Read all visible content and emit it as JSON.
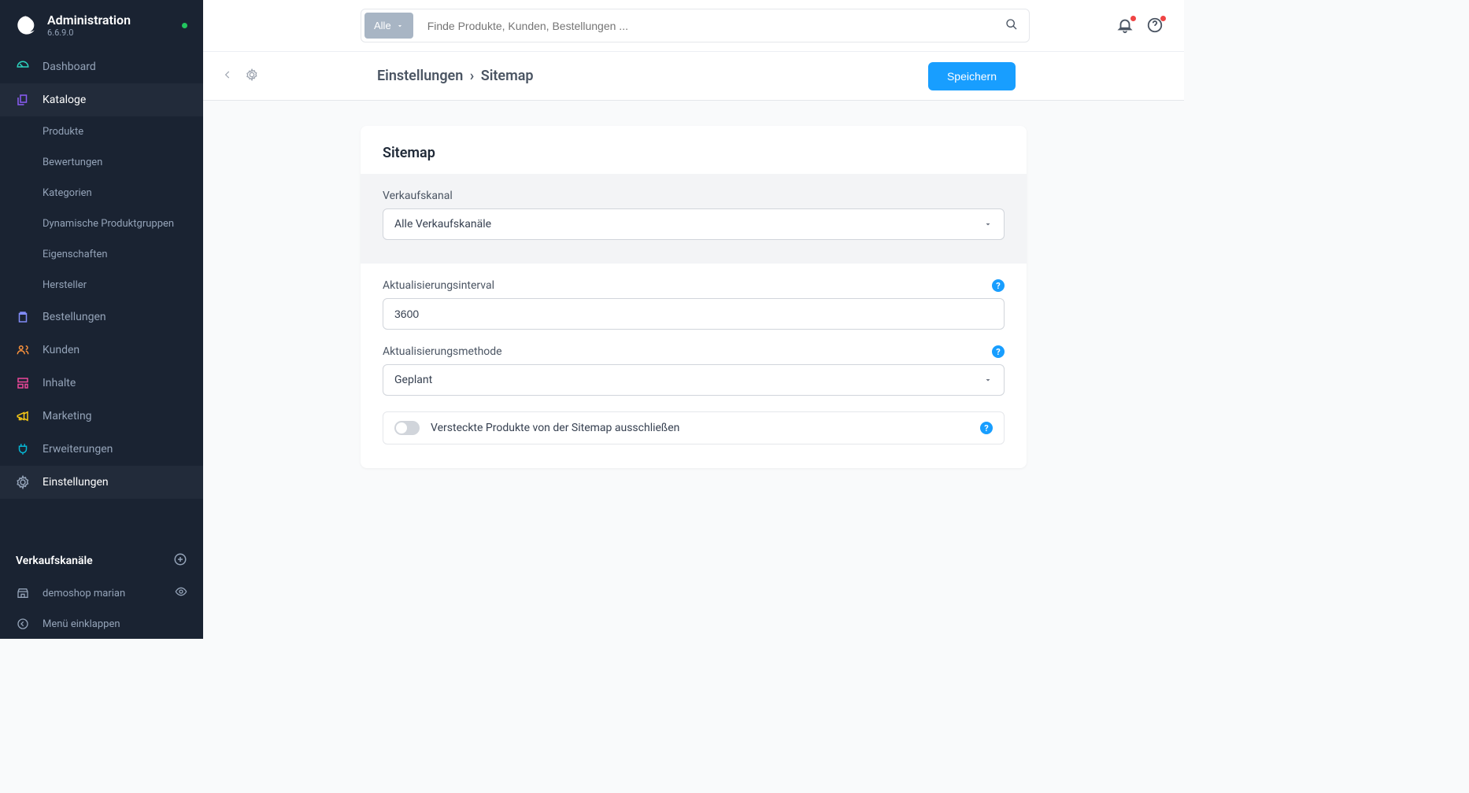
{
  "app": {
    "title": "Administration",
    "version": "6.6.9.0"
  },
  "nav": {
    "dashboard": "Dashboard",
    "catalogs": "Kataloge",
    "catalogs_sub": {
      "products": "Produkte",
      "reviews": "Bewertungen",
      "categories": "Kategorien",
      "dyn_groups": "Dynamische Produktgruppen",
      "properties": "Eigenschaften",
      "manufacturers": "Hersteller"
    },
    "orders": "Bestellungen",
    "customers": "Kunden",
    "content": "Inhalte",
    "marketing": "Marketing",
    "extensions": "Erweiterungen",
    "settings": "Einstellungen"
  },
  "sidebar_extras": {
    "channels_title": "Verkaufskanäle",
    "channel_1": "demoshop marian",
    "collapse": "Menü einklappen"
  },
  "search": {
    "type_label": "Alle",
    "placeholder": "Finde Produkte, Kunden, Bestellungen ..."
  },
  "breadcrumb": {
    "parent": "Einstellungen",
    "current": "Sitemap"
  },
  "save_label": "Speichern",
  "card": {
    "title": "Sitemap",
    "channel_label": "Verkaufskanal",
    "channel_value": "Alle Verkaufskanäle",
    "interval_label": "Aktualisierungsinterval",
    "interval_value": "3600",
    "method_label": "Aktualisierungsmethode",
    "method_value": "Geplant",
    "exclude_label": "Versteckte Produkte von der Sitemap ausschließen"
  }
}
